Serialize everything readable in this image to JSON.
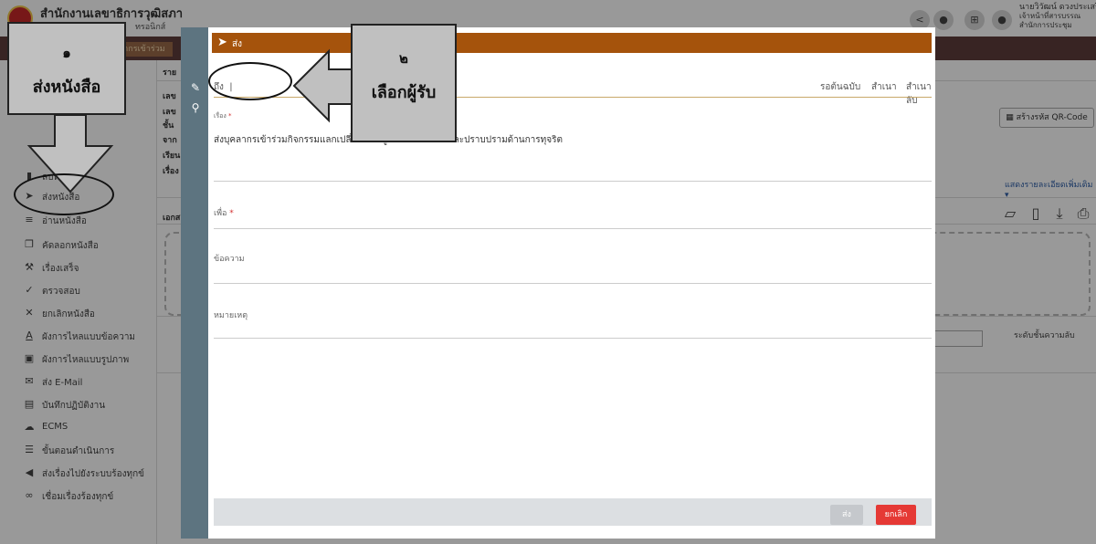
{
  "header": {
    "title": "สำนักงานเลขาธิการวุฒิสภา",
    "subtitle": "ทรอนิกส์",
    "user_name": "นายวิวัฒน์ ดวงประเสริฐ",
    "user_role": "เจ้าหน้าที่สารบรรณ",
    "user_dept": "สำนักการประชุม"
  },
  "banner": {
    "tab_label": "บุคลากรเข้าร่วม"
  },
  "sidebar": {
    "items": [
      {
        "label": "ลบหนังสือ",
        "icon": "trash-icon"
      },
      {
        "label": "ส่งหนังสือ",
        "icon": "send-icon"
      },
      {
        "label": "อ่านหนังสือ",
        "icon": "read-icon"
      },
      {
        "label": "คัดลอกหนังสือ",
        "icon": "copy-icon"
      },
      {
        "label": "เรื่องเสร็จ",
        "icon": "gavel-icon"
      },
      {
        "label": "ตรวจสอบ",
        "icon": "check-icon"
      },
      {
        "label": "ยกเลิกหนังสือ",
        "icon": "close-icon"
      },
      {
        "label": "ผังการไหลแบบข้อความ",
        "icon": "text-flow-icon"
      },
      {
        "label": "ผังการไหลแบบรูปภาพ",
        "icon": "image-icon"
      },
      {
        "label": "ส่ง E-Mail",
        "icon": "mail-icon"
      },
      {
        "label": "บันทึกปฏิบัติงาน",
        "icon": "note-icon"
      },
      {
        "label": "ECMS",
        "icon": "cloud-icon"
      },
      {
        "label": "ขั้นตอนดำเนินการ",
        "icon": "list-icon"
      },
      {
        "label": "ส่งเรื่องไปยังระบบร้องทุกข์",
        "icon": "send-arrow-icon"
      },
      {
        "label": "เชื่อมเรื่องร้องทุกข์",
        "icon": "link-icon"
      }
    ]
  },
  "content": {
    "info_labels": [
      "ราย",
      "เลข",
      "เลข",
      "ชั้น",
      "จาก",
      "เรียน",
      "เรื่อง"
    ],
    "attach_label": "เอกส",
    "qr_button": "สร้างรหัส QR-Code",
    "more_link": "แสดงรายละเอียดเพิ่มเติม ▾",
    "secret_label": "ระดับชั้นความลับ"
  },
  "modal": {
    "title": "ส่ง",
    "to_label": "ถึง",
    "cc_labels": [
      "รอต้นฉบับ",
      "สำเนา",
      "สำเนาลับ"
    ],
    "subject_label": "เรื่อง",
    "subject_value": "ส่งบุคลากรเข้าร่วมกิจกรรมแลกเปลี่ยนเรียนรู้ด้านการป้องกันและปราบปรามด้านการทุจริต",
    "purpose_label": "เพื่อ",
    "message_label": "ข้อความ",
    "note_label": "หมายเหตุ",
    "send_button": "ส่ง",
    "cancel_button": "ยกเลิก"
  },
  "annotations": {
    "callout1_num": "๑",
    "callout1_text": "ส่งหนังสือ",
    "callout2_num": "๒",
    "callout2_text": "เลือกผู้รับ"
  }
}
